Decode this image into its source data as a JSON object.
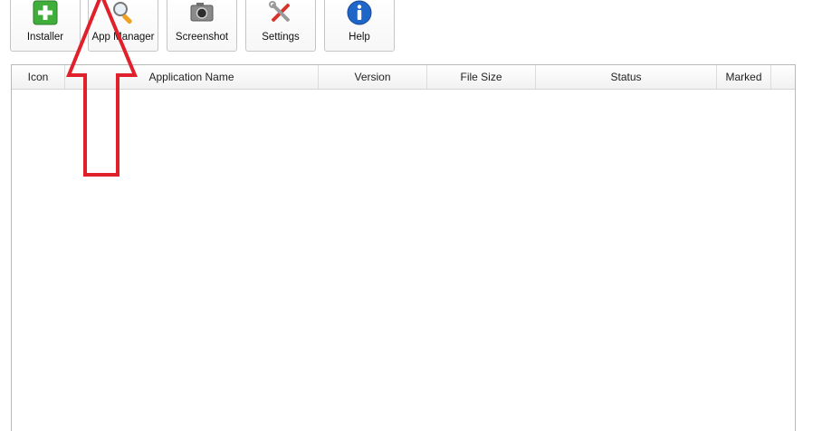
{
  "toolbar": {
    "buttons": [
      {
        "label": "Installer",
        "icon": "installer-plus-icon"
      },
      {
        "label": "App Manager",
        "icon": "app-manager-magnifier-icon"
      },
      {
        "label": "Screenshot",
        "icon": "camera-icon"
      },
      {
        "label": "Settings",
        "icon": "tools-icon"
      },
      {
        "label": "Help",
        "icon": "info-icon"
      }
    ]
  },
  "table": {
    "columns": [
      "Icon",
      "Application Name",
      "Version",
      "File Size",
      "Status",
      "Marked"
    ],
    "rows": []
  },
  "annotation": {
    "type": "arrow-up",
    "color": "#e0202a"
  },
  "colors": {
    "installer_green": "#3fae3a",
    "help_blue": "#1f66c8",
    "arrow_red": "#e0202a"
  }
}
